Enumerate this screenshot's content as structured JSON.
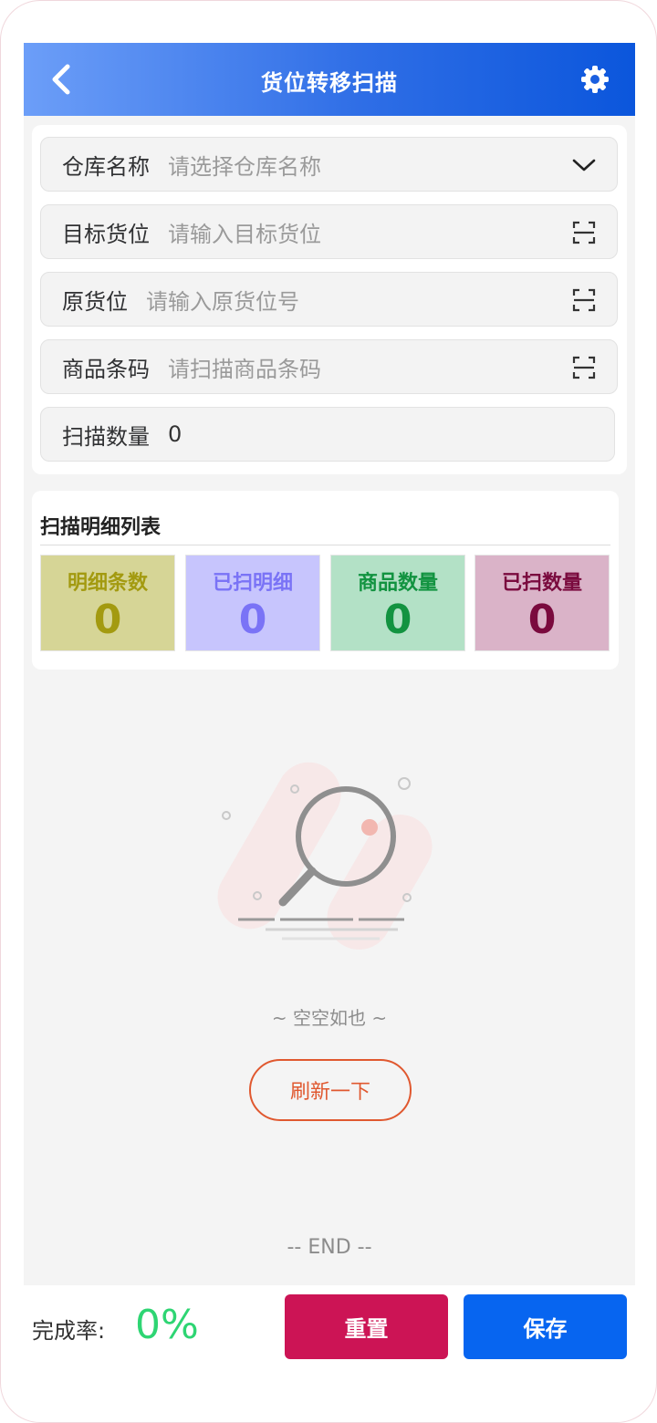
{
  "header": {
    "title": "货位转移扫描"
  },
  "form": {
    "fields": [
      {
        "label": "仓库名称",
        "placeholder": "请选择仓库名称"
      },
      {
        "label": "目标货位",
        "placeholder": "请输入目标货位"
      },
      {
        "label": "原货位",
        "placeholder": "请输入原货位号"
      },
      {
        "label": "商品条码",
        "placeholder": "请扫描商品条码"
      },
      {
        "label": "扫描数量",
        "value": "0"
      }
    ]
  },
  "detail": {
    "title": "扫描明细列表",
    "stats": [
      {
        "label": "明细条数",
        "value": "0",
        "bg": "#d6d596",
        "color": "#a39a10"
      },
      {
        "label": "已扫明细",
        "value": "0",
        "bg": "#c7c5fd",
        "color": "#7a73f6"
      },
      {
        "label": "商品数量",
        "value": "0",
        "bg": "#b3e1c6",
        "color": "#129340"
      },
      {
        "label": "已扫数量",
        "value": "0",
        "bg": "#dab3c8",
        "color": "#7a0a3e"
      }
    ]
  },
  "empty": {
    "text": "~ 空空如也 ~",
    "refresh_label": "刷新一下",
    "end_text": "-- END --"
  },
  "bottom": {
    "rate_label": "完成率:",
    "rate_value": "0%",
    "reset_label": "重置",
    "save_label": "保存"
  },
  "colors": {
    "header_start": "#6c9ef8",
    "header_end": "#0b56dc",
    "reset": "#cc1455",
    "save": "#0765f0",
    "rate": "#2ed573",
    "refresh": "#e0582f"
  },
  "icons": {
    "back": "chevron-left-icon",
    "settings": "gear-icon",
    "dropdown": "chevron-down-icon",
    "scan": "scan-icon",
    "empty": "magnifier-icon"
  }
}
